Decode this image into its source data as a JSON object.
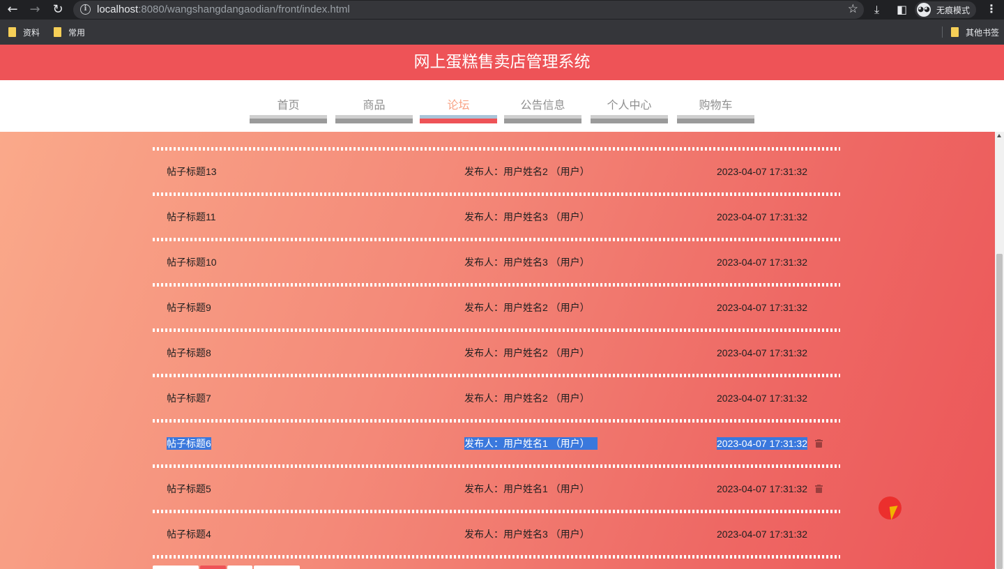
{
  "browser": {
    "url_host": "localhost",
    "url_rest": ":8080/wangshangdangaodian/front/index.html",
    "incognito_label": "无痕模式",
    "bookmarks": [
      {
        "label": "资料"
      },
      {
        "label": "常用"
      }
    ],
    "other_bookmarks": "其他书签"
  },
  "site": {
    "title": "网上蛋糕售卖店管理系统",
    "nav": [
      {
        "label": "首页",
        "active": false
      },
      {
        "label": "商品",
        "active": false
      },
      {
        "label": "论坛",
        "active": true
      },
      {
        "label": "公告信息",
        "active": false
      },
      {
        "label": "个人中心",
        "active": false
      },
      {
        "label": "购物车",
        "active": false
      }
    ]
  },
  "forum": {
    "posts": [
      {
        "title": "帖子标题13",
        "author": "发布人：用户姓名2 （用户）",
        "time": "2023-04-07 17:31:32",
        "selected": false,
        "deletable": false
      },
      {
        "title": "帖子标题11",
        "author": "发布人：用户姓名3 （用户）",
        "time": "2023-04-07 17:31:32",
        "selected": false,
        "deletable": false
      },
      {
        "title": "帖子标题10",
        "author": "发布人：用户姓名3 （用户）",
        "time": "2023-04-07 17:31:32",
        "selected": false,
        "deletable": false
      },
      {
        "title": "帖子标题9",
        "author": "发布人：用户姓名2 （用户）",
        "time": "2023-04-07 17:31:32",
        "selected": false,
        "deletable": false
      },
      {
        "title": "帖子标题8",
        "author": "发布人：用户姓名2 （用户）",
        "time": "2023-04-07 17:31:32",
        "selected": false,
        "deletable": false
      },
      {
        "title": "帖子标题7",
        "author": "发布人：用户姓名2 （用户）",
        "time": "2023-04-07 17:31:32",
        "selected": false,
        "deletable": false
      },
      {
        "title": "帖子标题6",
        "author": "发布人：用户姓名1 （用户）",
        "time": "2023-04-07 17:31:32",
        "selected": true,
        "deletable": true
      },
      {
        "title": "帖子标题5",
        "author": "发布人：用户姓名1 （用户）",
        "time": "2023-04-07 17:31:32",
        "selected": false,
        "deletable": true
      },
      {
        "title": "帖子标题4",
        "author": "发布人：用户姓名3 （用户）",
        "time": "2023-04-07 17:31:32",
        "selected": false,
        "deletable": false
      }
    ]
  },
  "colors": {
    "header": "#ee5357",
    "nav_active_text": "#f9a183",
    "selection": "#3a78dd",
    "trash_icon": "#9b3f3e"
  },
  "icons": {
    "back": "arrow-left-icon",
    "forward": "arrow-right-icon",
    "reload": "reload-icon",
    "info": "info-icon",
    "bookmark_star": "star-icon",
    "download": "download-icon",
    "side_panel": "side-panel-icon",
    "menu": "kebab-menu-icon",
    "folder": "folder-icon",
    "delete": "trash-icon"
  }
}
